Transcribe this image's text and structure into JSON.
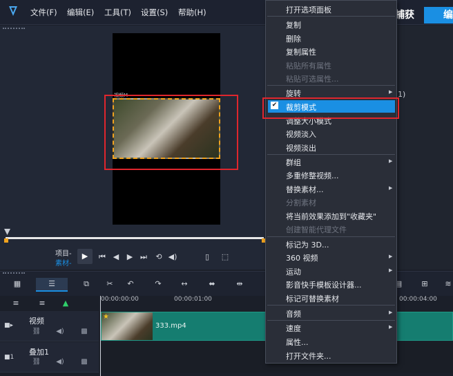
{
  "menubar": {
    "items": [
      "文件(F)",
      "编辑(E)",
      "工具(T)",
      "设置(S)",
      "帮助(H)"
    ],
    "tab_capture": "捕获",
    "tab_edit": "编"
  },
  "preview": {
    "clip_label": "视频M"
  },
  "player": {
    "mode_project": "项目-",
    "mode_clip": "素材-"
  },
  "timeline": {
    "ruler": [
      "00:00:00:00",
      "00:00:01:00",
      "00:00:04:00"
    ],
    "tracks": [
      {
        "name": "视频"
      },
      {
        "name": "叠加1"
      }
    ],
    "clip_name": "333.mp4"
  },
  "context_menu": {
    "items": [
      {
        "label": "打开选项面板",
        "disabled": false
      },
      {
        "label": "复制",
        "disabled": false
      },
      {
        "label": "删除",
        "disabled": false
      },
      {
        "label": "复制属性",
        "disabled": false
      },
      {
        "label": "粘贴所有属性",
        "disabled": true
      },
      {
        "label": "粘贴可选属性...",
        "disabled": true
      },
      {
        "label": "旋转",
        "disabled": false
      },
      {
        "label": "裁剪模式",
        "disabled": false,
        "checked": true
      },
      {
        "label": "调整大小模式",
        "disabled": false
      },
      {
        "label": "视频淡入",
        "disabled": false
      },
      {
        "label": "视频淡出",
        "disabled": false
      },
      {
        "label": "群组",
        "disabled": false
      },
      {
        "label": "多重修整视频...",
        "disabled": false
      },
      {
        "label": "替换素材...",
        "disabled": false
      },
      {
        "label": "分割素材",
        "disabled": true
      },
      {
        "label": "将当前效果添加到\"收藏夹\"",
        "disabled": false
      },
      {
        "label": "创建智能代理文件",
        "disabled": true
      },
      {
        "label": "标记为 3D...",
        "disabled": false
      },
      {
        "label": "360 视频",
        "disabled": false
      },
      {
        "label": "运动",
        "disabled": false
      },
      {
        "label": "影音快手模板设计器...",
        "disabled": false
      },
      {
        "label": "标记可替换素材",
        "disabled": false
      },
      {
        "label": "音频",
        "disabled": false
      },
      {
        "label": "速度",
        "disabled": false
      },
      {
        "label": "属性...",
        "disabled": false
      },
      {
        "label": "打开文件夹...",
        "disabled": false
      }
    ]
  },
  "partial_text": "1)",
  "colors": {
    "accent": "#1a8fe3",
    "annotation_red": "#e0262d",
    "crop_border": "#f0a21e",
    "clip_green": "#157d70"
  }
}
